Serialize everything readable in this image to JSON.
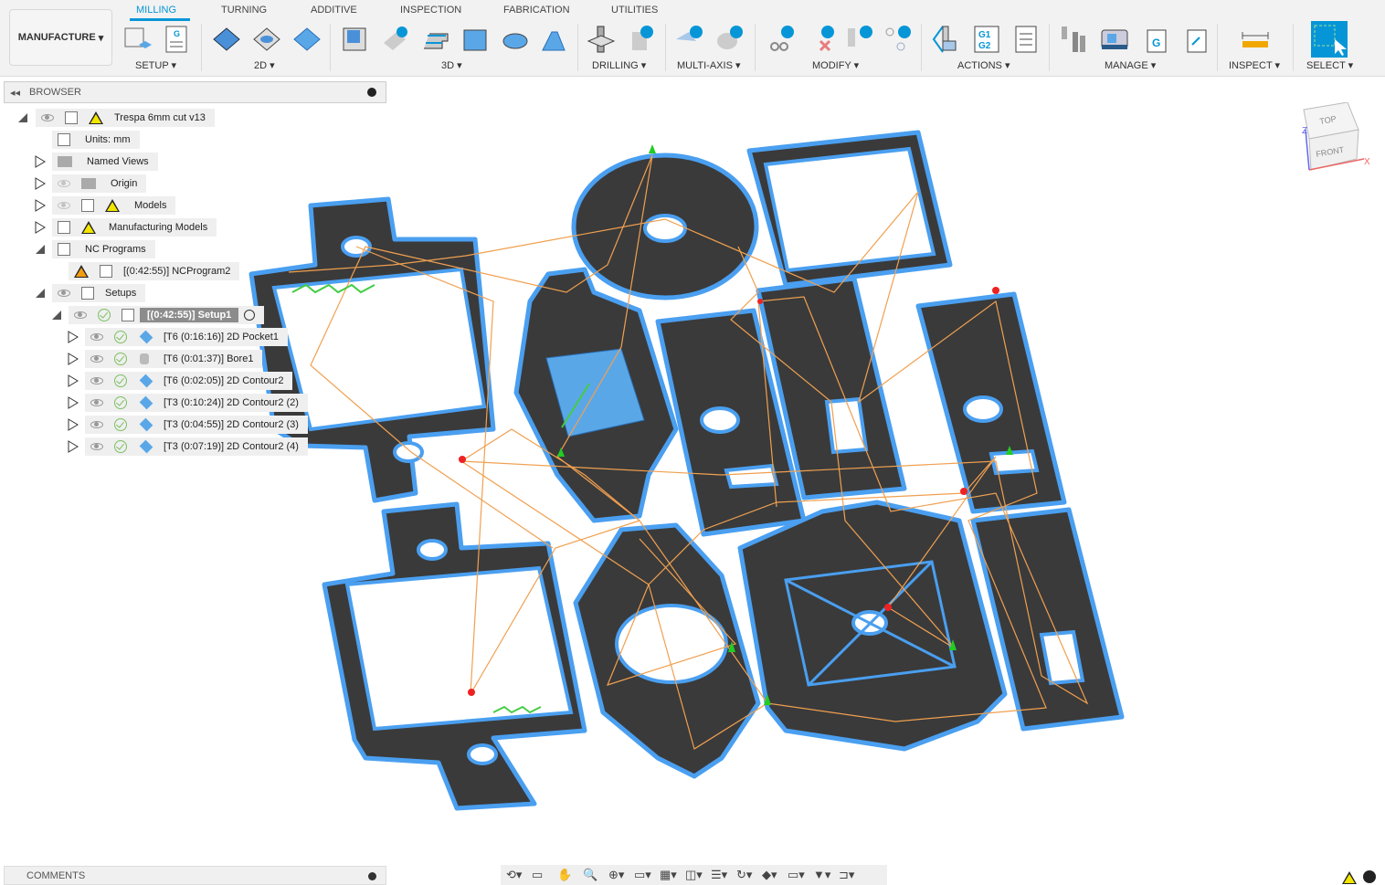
{
  "workspace": {
    "label": "MANUFACTURE"
  },
  "tabs": [
    "MILLING",
    "TURNING",
    "ADDITIVE",
    "INSPECTION",
    "FABRICATION",
    "UTILITIES"
  ],
  "active_tab": "MILLING",
  "groups": [
    "SETUP",
    "2D",
    "3D",
    "DRILLING",
    "MULTI-AXIS",
    "MODIFY",
    "ACTIONS",
    "MANAGE",
    "INSPECT",
    "SELECT"
  ],
  "browser": {
    "title": "BROWSER",
    "root": "Trespa 6mm cut v13",
    "units": "Units: mm",
    "named_views": "Named Views",
    "origin": "Origin",
    "models": "Models",
    "mfg_models": "Manufacturing Models",
    "nc_programs": "NC Programs",
    "nc_program": "[(0:42:55)] NCProgram2",
    "setups": "Setups",
    "setup1": "[(0:42:55)] Setup1",
    "operations": [
      "[T6 (0:16:16)] 2D Pocket1",
      "[T6 (0:01:37)] Bore1",
      "[T6 (0:02:05)] 2D Contour2",
      "[T3 (0:10:24)] 2D Contour2 (2)",
      "[T3 (0:04:55)] 2D Contour2 (3)",
      "[T3 (0:07:19)] 2D Contour2 (4)"
    ]
  },
  "viewcube": {
    "top": "TOP",
    "front": "FRONT",
    "x": "X",
    "z": "Z"
  },
  "comments": {
    "title": "COMMENTS"
  },
  "colors": {
    "accent": "#0696d7",
    "part": "#3a3a3a",
    "outline": "#4a9ff0",
    "toolpath": "#f0a050"
  }
}
